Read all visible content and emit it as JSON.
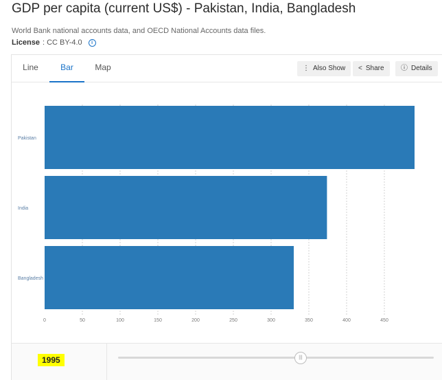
{
  "header": {
    "title": "GDP per capita (current US$) - Pakistan, India, Bangladesh",
    "source": "World Bank national accounts data, and OECD National Accounts data files.",
    "license_label": "License",
    "license_value": ": CC BY-4.0"
  },
  "tabs": [
    {
      "label": "Line",
      "active": false
    },
    {
      "label": "Bar",
      "active": true
    },
    {
      "label": "Map",
      "active": false
    }
  ],
  "toolbar": {
    "also_show": "Also Show",
    "share": "Share",
    "details": "Details"
  },
  "timeline": {
    "year": "1995"
  },
  "colors": {
    "bar": "#2a7ab7",
    "accent": "#1a73c8",
    "year_highlight": "#ffff00"
  },
  "chart_data": {
    "type": "bar",
    "orientation": "horizontal",
    "categories": [
      "Pakistan",
      "India",
      "Bangladesh"
    ],
    "values": [
      490,
      374,
      330
    ],
    "xlim": [
      0,
      500
    ],
    "xticks": [
      0,
      50,
      100,
      150,
      200,
      250,
      300,
      350,
      400,
      450
    ],
    "grid": true,
    "title": "",
    "xlabel": "",
    "ylabel": ""
  }
}
